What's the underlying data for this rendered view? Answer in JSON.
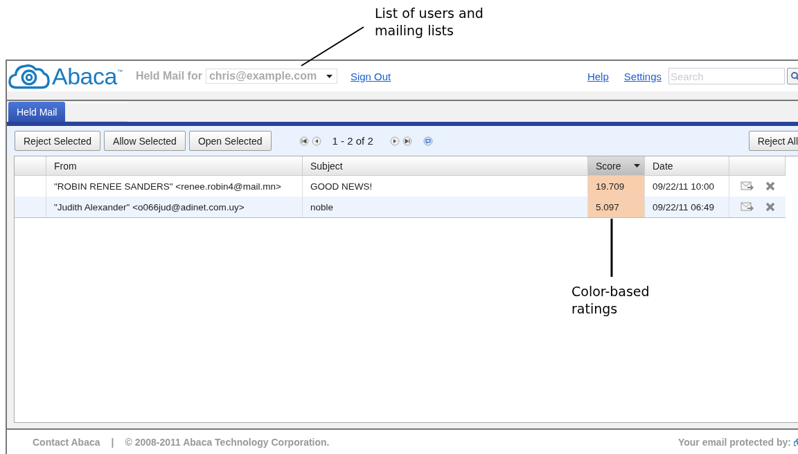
{
  "annotations": [
    {
      "kind": "top",
      "lines": [
        "List of users and",
        "mailing lists"
      ]
    },
    {
      "kind": "bottom",
      "lines": [
        "Color-based",
        "ratings"
      ]
    }
  ],
  "header": {
    "brand": "Abaca",
    "trademark": "™",
    "held_for_label": "Held Mail for",
    "account": "chris@example.com",
    "sign_out": "Sign Out",
    "links": [
      "Help",
      "Settings"
    ],
    "search": {
      "placeholder": "Search"
    }
  },
  "tabs": [
    {
      "kind": "text",
      "label": "Held Mail",
      "selected": true
    },
    {
      "kind": "blank",
      "selected": false
    }
  ],
  "toolbar": {
    "buttons": [
      "Reject Selected",
      "Allow Selected",
      "Open Selected"
    ],
    "pager": "1 - 2 of 2",
    "right_button": "Reject All"
  },
  "table": {
    "columns": [
      {
        "label": "From",
        "sorted": false
      },
      {
        "label": "Subject",
        "sorted": false
      },
      {
        "label": "Score",
        "sorted": true
      },
      {
        "label": "Date",
        "sorted": false
      }
    ],
    "rows": [
      {
        "from": "\"ROBIN RENEE SANDERS\" <renee.robin4@mail.mn>",
        "subject": "GOOD NEWS!",
        "score": "19.709",
        "color": "#f8cfae",
        "date": "09/22/11 10:00"
      },
      {
        "from": "\"Judith Alexander\" <o066jud@adinet.com.uy>",
        "subject": "noble",
        "score": "5.097",
        "color": "#f8cfae",
        "date": "09/22/11 06:49"
      }
    ]
  },
  "footer": {
    "contact": "Contact Abaca",
    "separator": "|",
    "copyright": "© 2008-2011 Abaca Technology Corporation.",
    "protected": "Your email protected by:"
  }
}
